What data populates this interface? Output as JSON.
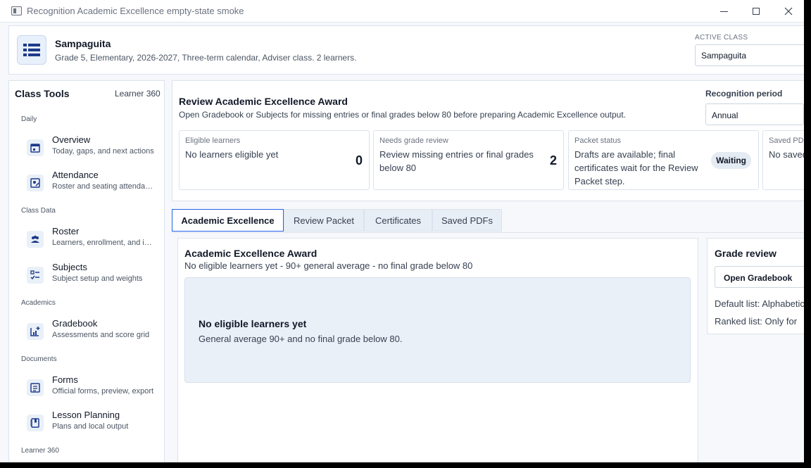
{
  "window": {
    "title": "Recognition Academic Excellence empty-state smoke"
  },
  "header": {
    "class_name": "Sampaguita",
    "class_desc": "Grade 5, Elementary, 2026-2027, Three-term calendar, Adviser class. 2 learners.",
    "active_label": "ACTIVE CLASS",
    "active_value": "Sampaguita"
  },
  "sidebar": {
    "title": "Class Tools",
    "link": "Learner 360",
    "groups": [
      "Daily",
      "Class Data",
      "Academics",
      "Documents",
      "Learner 360"
    ],
    "items": [
      {
        "label": "Overview",
        "sub": "Today, gaps, and next actions",
        "icon": "calendar-icon"
      },
      {
        "label": "Attendance",
        "sub": "Roster and seating attendance",
        "icon": "attendance-icon"
      },
      {
        "label": "Roster",
        "sub": "Learners, enrollment, and im...",
        "icon": "people-icon"
      },
      {
        "label": "Subjects",
        "sub": "Subject setup and weights",
        "icon": "checklist-icon"
      },
      {
        "label": "Gradebook",
        "sub": "Assessments and score grid",
        "icon": "chart-add-icon"
      },
      {
        "label": "Forms",
        "sub": "Official forms, preview, export",
        "icon": "form-icon"
      },
      {
        "label": "Lesson Planning",
        "sub": "Plans and local output",
        "icon": "notebook-icon"
      }
    ]
  },
  "summary": {
    "title": "Review Academic Excellence Award",
    "desc": "Open Gradebook or Subjects for missing entries or final grades below 80 before preparing Academic Excellence output.",
    "period_label": "Recognition period",
    "period_value": "Annual",
    "cards": [
      {
        "label": "Eligible learners",
        "text": "No learners eligible yet",
        "value": "0"
      },
      {
        "label": "Needs grade review",
        "text": "Review missing entries or final grades below 80",
        "value": "2"
      },
      {
        "label": "Packet status",
        "text": "Drafts are available; final certificates wait for the Review Packet step.",
        "badge": "Waiting"
      },
      {
        "label": "Saved PDFs",
        "text": "No saved"
      }
    ]
  },
  "tabs": [
    "Academic Excellence",
    "Review Packet",
    "Certificates",
    "Saved PDFs"
  ],
  "award": {
    "title": "Academic Excellence Award",
    "sub": "No eligible learners yet - 90+ general average - no final grade below 80",
    "empty_title": "No eligible learners yet",
    "empty_sub": "General average 90+ and no final grade below 80."
  },
  "grade_review": {
    "title": "Grade review",
    "button": "Open Gradebook",
    "default_list": "Default list: Alphabetical",
    "ranked_list": "Ranked list: Only for"
  }
}
